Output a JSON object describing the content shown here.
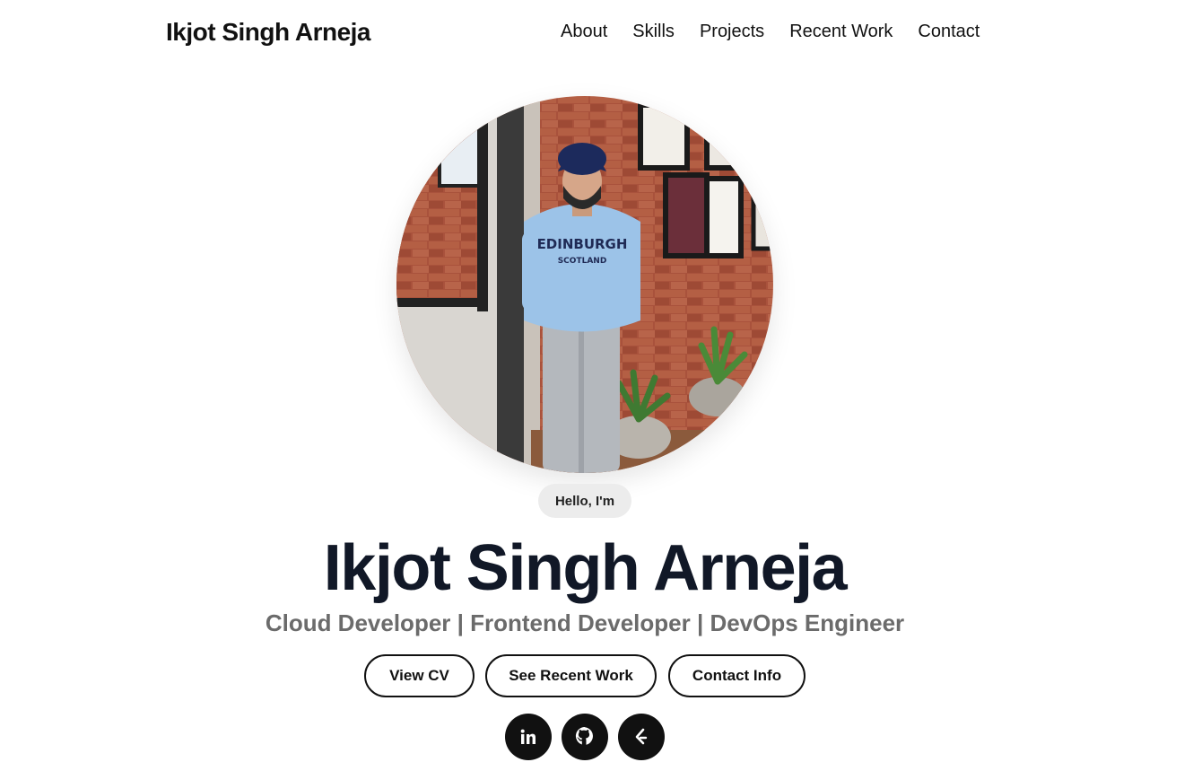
{
  "header": {
    "brand": "Ikjot Singh Arneja",
    "nav": [
      {
        "label": "About"
      },
      {
        "label": "Skills"
      },
      {
        "label": "Projects"
      },
      {
        "label": "Recent Work"
      },
      {
        "label": "Contact"
      }
    ]
  },
  "hero": {
    "greeting": "Hello, I'm",
    "name": "Ikjot Singh Arneja",
    "roles": "Cloud Developer | Frontend Developer | DevOps Engineer",
    "buttons": [
      {
        "label": "View CV"
      },
      {
        "label": "See Recent Work"
      },
      {
        "label": "Contact Info"
      }
    ],
    "socials": [
      {
        "icon": "linkedin-icon"
      },
      {
        "icon": "github-icon"
      },
      {
        "icon": "leetcode-icon"
      }
    ]
  },
  "colors": {
    "text": "#111111",
    "subtitle": "#6b6b6b",
    "pill_bg": "#ececec",
    "social_bg": "#111111"
  }
}
